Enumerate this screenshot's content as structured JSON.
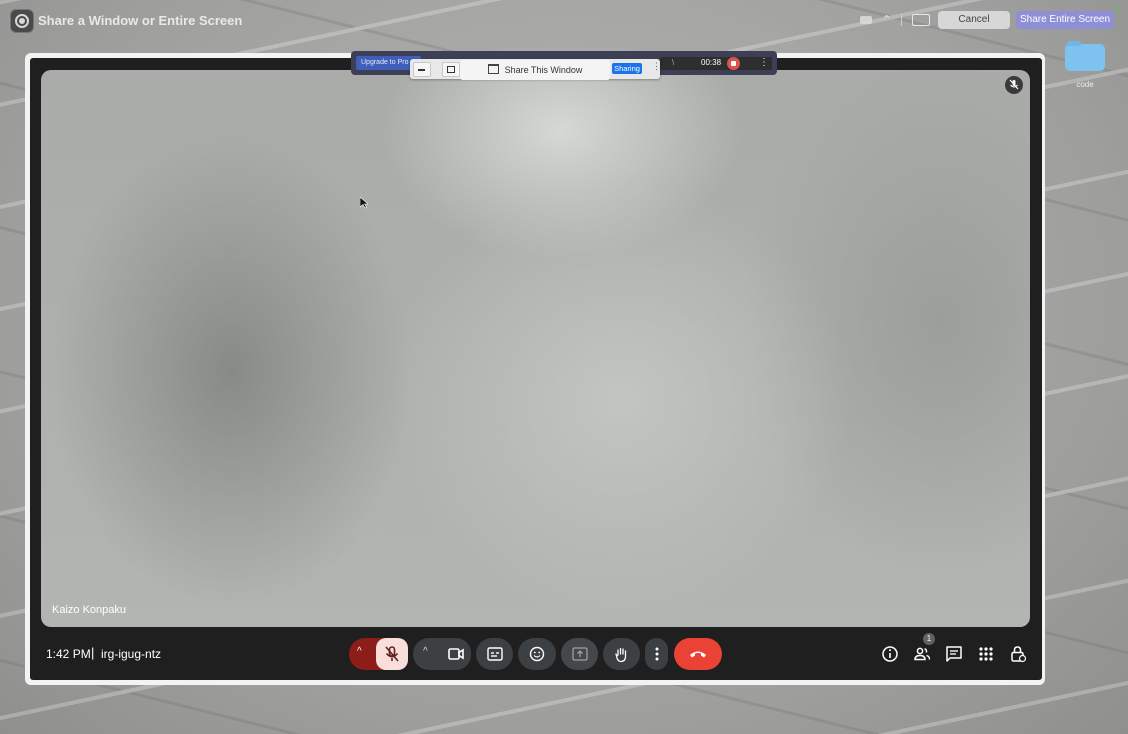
{
  "share_bar": {
    "title": "Share a Window or Entire Screen",
    "cancel_label": "Cancel",
    "share_entire_label": "Share Entire Screen"
  },
  "desktop": {
    "folder_label": "code"
  },
  "overlay": {
    "upgrade_label": "Upgrade to Pro",
    "share_this_window_label": "Share This Window",
    "sharing_badge": "Sharing",
    "timer": "00:38"
  },
  "meeting": {
    "participant_name": "Kaizo Konpaku",
    "time": "1:42 PM",
    "separator": "|",
    "code": "irg-igug-ntz",
    "people_count": "1"
  },
  "colors": {
    "end_call": "#ea4335",
    "mic_off_bg": "#8c1d18",
    "share_entire_bg": "#8f8fd6",
    "sharing_badge": "#1a73e8"
  },
  "icons": {
    "app": "screen-share-app-icon",
    "mic": "mic-off-icon",
    "camera": "videocam-icon",
    "captions": "closed-captions-icon",
    "emoji": "emoji-icon",
    "present": "present-screen-icon",
    "hand": "raise-hand-icon",
    "more": "more-vert-icon",
    "end": "call-end-icon",
    "info": "info-icon",
    "people": "people-icon",
    "chat": "chat-icon",
    "activities": "apps-grid-icon",
    "host": "lock-person-icon"
  }
}
